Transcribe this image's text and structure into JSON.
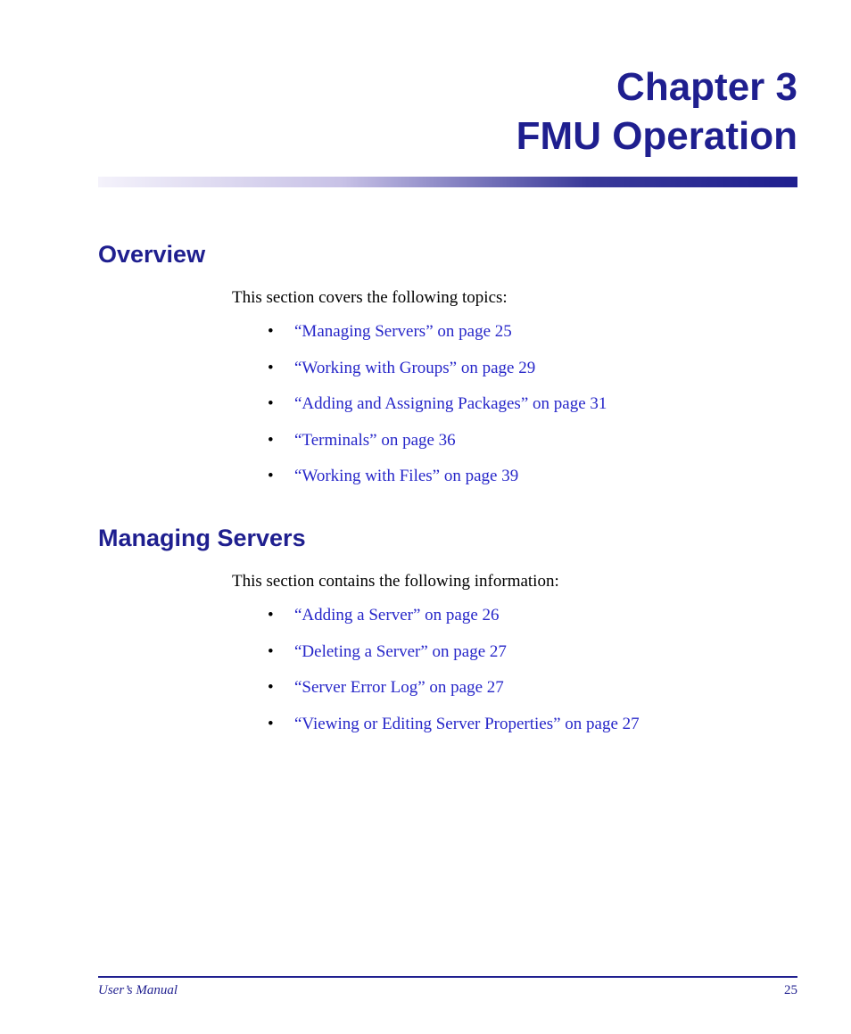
{
  "chapter": {
    "line1": "Chapter 3",
    "line2": "FMU Operation"
  },
  "sections": {
    "overview": {
      "heading": "Overview",
      "intro": "This section covers the following topics:",
      "items": [
        "“Managing Servers” on page 25",
        "“Working with Groups” on page 29",
        "“Adding and Assigning Packages” on page 31",
        "“Terminals” on page 36",
        "“Working with Files” on page 39"
      ]
    },
    "managing_servers": {
      "heading": "Managing Servers",
      "intro": "This section contains the following information:",
      "items": [
        "“Adding a Server” on page 26",
        "“Deleting a Server” on page 27",
        "“Server Error Log” on page 27",
        "“Viewing or Editing Server Properties” on page 27"
      ]
    }
  },
  "footer": {
    "left": "User’s Manual",
    "right": "25"
  }
}
